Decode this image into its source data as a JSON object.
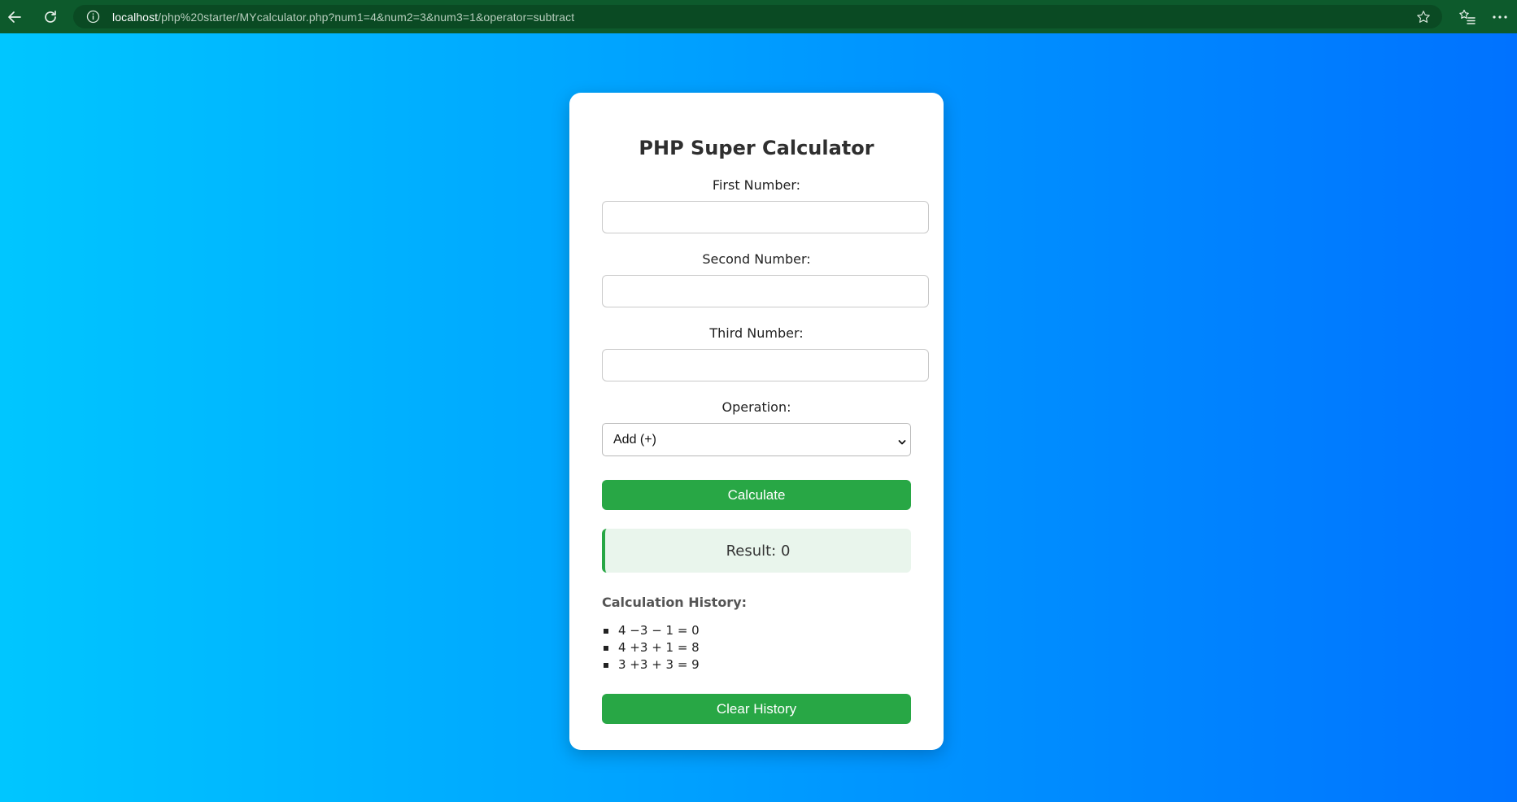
{
  "browser": {
    "url_host": "localhost",
    "url_path": "/php%20starter/MYcalculator.php?num1=4&num2=3&num3=1&operator=subtract"
  },
  "calculator": {
    "title": "PHP Super Calculator",
    "first_label": "First Number:",
    "first_value": "",
    "second_label": "Second Number:",
    "second_value": "",
    "third_label": "Third Number:",
    "third_value": "",
    "operation_label": "Operation:",
    "operation_selected": "Add (+)",
    "calculate_label": "Calculate",
    "result_text": "Result: 0",
    "history_title": "Calculation History:",
    "history": [
      "4 −3 − 1 = 0",
      "4 +3 + 1 = 8",
      "3 +3 + 3 = 9"
    ],
    "clear_label": "Clear History"
  },
  "colors": {
    "gradient_start": "#00c6ff",
    "gradient_end": "#0072ff",
    "button": "#28a745",
    "result_bg": "#e9f5ec",
    "browser_bar": "#0d5a2c"
  }
}
